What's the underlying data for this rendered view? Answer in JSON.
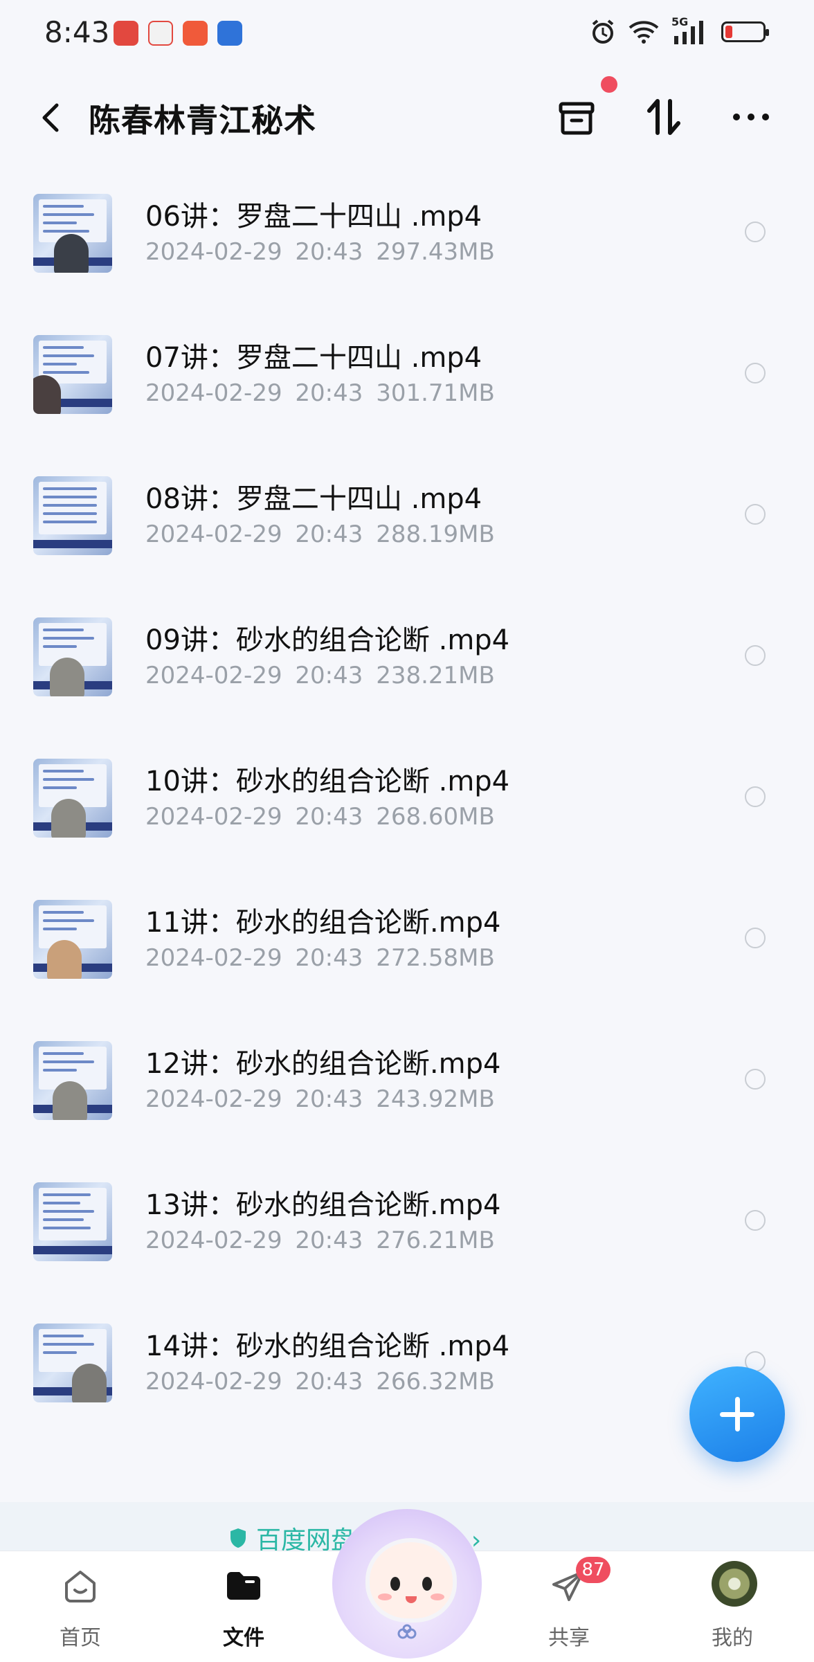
{
  "status_bar": {
    "time": "8:43",
    "network": "5G"
  },
  "header": {
    "title": "陈春林青江秘术"
  },
  "files": [
    {
      "name": "06讲：罗盘二十四山 .mp4",
      "date": "2024-02-29",
      "time": "20:43",
      "size": "297.43MB"
    },
    {
      "name": "07讲：罗盘二十四山 .mp4",
      "date": "2024-02-29",
      "time": "20:43",
      "size": "301.71MB"
    },
    {
      "name": "08讲：罗盘二十四山 .mp4",
      "date": "2024-02-29",
      "time": "20:43",
      "size": "288.19MB"
    },
    {
      "name": "09讲：砂水的组合论断 .mp4",
      "date": "2024-02-29",
      "time": "20:43",
      "size": "238.21MB"
    },
    {
      "name": "10讲：砂水的组合论断 .mp4",
      "date": "2024-02-29",
      "time": "20:43",
      "size": "268.60MB"
    },
    {
      "name": "11讲：砂水的组合论断.mp4",
      "date": "2024-02-29",
      "time": "20:43",
      "size": "272.58MB"
    },
    {
      "name": "12讲：砂水的组合论断.mp4",
      "date": "2024-02-29",
      "time": "20:43",
      "size": "243.92MB"
    },
    {
      "name": "13讲：砂水的组合论断.mp4",
      "date": "2024-02-29",
      "time": "20:43",
      "size": "276.21MB"
    },
    {
      "name": "14讲：砂水的组合论断 .mp4",
      "date": "2024-02-29",
      "time": "20:43",
      "size": "266.32MB"
    }
  ],
  "promo": {
    "text": "百度网盘 数据安全 ›"
  },
  "nav": {
    "home": "首页",
    "files": "文件",
    "share": "共享",
    "share_badge": "87",
    "mine": "我的"
  },
  "colors": {
    "accent": "#1c7fe8",
    "badge": "#ef4d5f",
    "promo": "#2bb7a5"
  }
}
